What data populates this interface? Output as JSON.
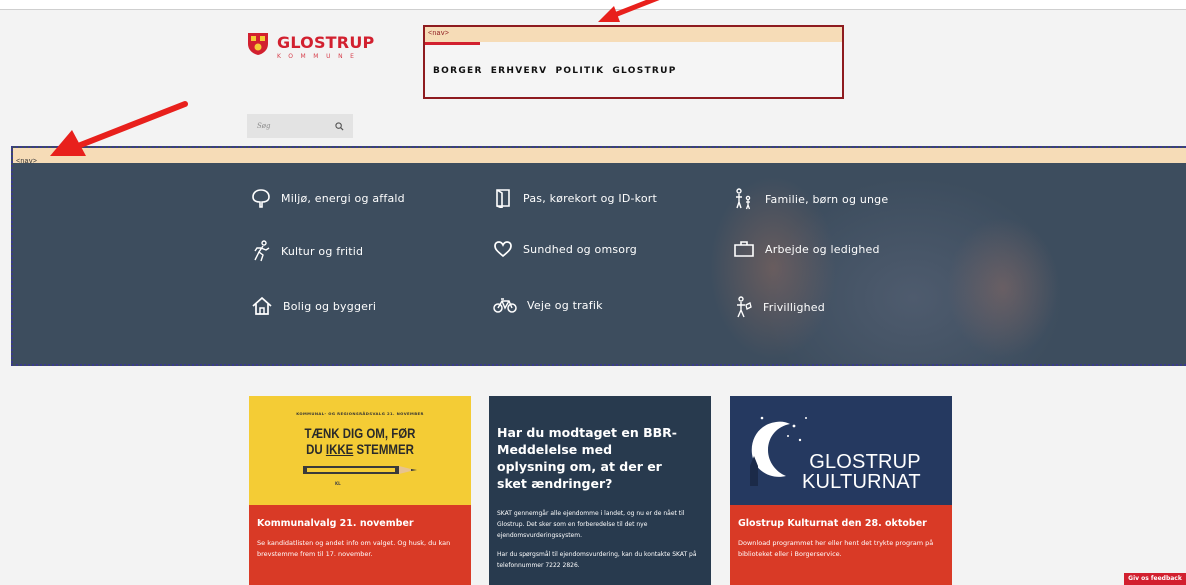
{
  "header": {
    "logo_name": "GLOSTRUP",
    "logo_sub": "KOMMUNE",
    "debug_tag": "<nav>",
    "nav_items": [
      "BORGER",
      "ERHVERV",
      "POLITIK",
      "GLOSTRUP"
    ],
    "search_placeholder": "Søg"
  },
  "hero": {
    "debug_tag": "<nav>",
    "categories": [
      {
        "label": "Miljø, energi og affald",
        "icon": "tree-icon"
      },
      {
        "label": "Pas, kørekort og ID-kort",
        "icon": "passport-icon"
      },
      {
        "label": "Familie, børn og unge",
        "icon": "family-icon"
      },
      {
        "label": "Kultur og fritid",
        "icon": "running-icon"
      },
      {
        "label": "Sundhed og omsorg",
        "icon": "heart-icon"
      },
      {
        "label": "Arbejde og ledighed",
        "icon": "briefcase-icon"
      },
      {
        "label": "Bolig og byggeri",
        "icon": "house-icon"
      },
      {
        "label": "Veje og trafik",
        "icon": "bicycle-icon"
      },
      {
        "label": "Frivillighed",
        "icon": "volunteer-icon"
      }
    ]
  },
  "cards": [
    {
      "image_small": "KOMMUNAL- OG REGIONSRÅDSVALG 21. NOVEMBER",
      "image_line1": "TÆNK DIG OM, FØR",
      "image_line2_pre": "DU ",
      "image_line2_u": "IKKE",
      "image_line2_post": " STEMMER",
      "image_logos": "KL",
      "title": "Kommunalvalg 21. november",
      "text": "Se kandidatlisten og andet info om valget. Og husk, du kan brevstemme frem til 17. november."
    },
    {
      "title": "Har du modtaget en BBR-Meddelelse med oplysning om, at der er sket ændringer?",
      "p1": "SKAT gennemgår alle ejendomme i landet, og nu er de nået til Glostrup. Det sker som en forberedelse til det nye ejendomsvurderingssystem.",
      "p2": "Har du spørgsmål til ejendomsvurdering, kan du kontakte SKAT på telefonnummer 7222 2826."
    },
    {
      "image_line1": "GLOSTRUP",
      "image_line2": "KULTURNAT",
      "title": "Glostrup Kulturnat den 28. oktober",
      "text": "Download programmet her eller hent det trykte program på biblioteket eller i Borgerservice."
    }
  ],
  "feedback_label": "Giv os feedback",
  "colors": {
    "brand_red": "#d2202f",
    "hero_bg": "#3d4d5e",
    "card_red": "#d93a26",
    "card_yellow": "#f4cc35",
    "card_navy": "#283a4e",
    "annotation_arrow": "#e8201c"
  }
}
